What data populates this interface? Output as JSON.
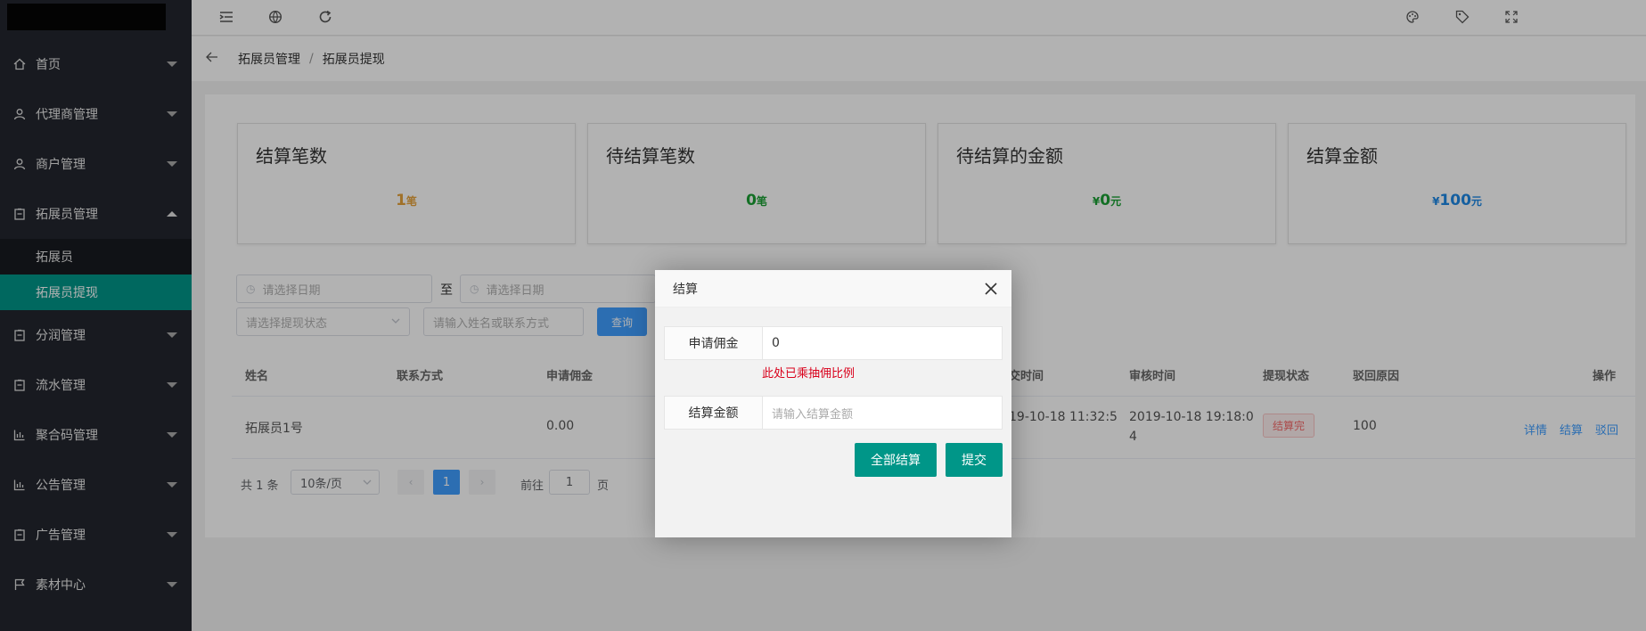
{
  "sidebar": {
    "items": [
      {
        "label": "首页",
        "icon": "home-icon"
      },
      {
        "label": "代理商管理",
        "icon": "user-icon"
      },
      {
        "label": "商户管理",
        "icon": "user-icon"
      },
      {
        "label": "拓展员管理",
        "icon": "clipboard-icon",
        "expanded": true,
        "children": [
          {
            "label": "拓展员"
          },
          {
            "label": "拓展员提现",
            "active": true
          }
        ]
      },
      {
        "label": "分润管理",
        "icon": "clipboard-icon"
      },
      {
        "label": "流水管理",
        "icon": "clipboard-icon"
      },
      {
        "label": "聚合码管理",
        "icon": "chart-icon"
      },
      {
        "label": "公告管理",
        "icon": "chart-icon"
      },
      {
        "label": "广告管理",
        "icon": "clipboard-icon"
      },
      {
        "label": "素材中心",
        "icon": "flag-icon"
      }
    ]
  },
  "topbar": {
    "icons": [
      "indent-icon",
      "globe-icon",
      "refresh-icon",
      "palette-icon",
      "tag-icon",
      "fullscreen-icon"
    ]
  },
  "breadcrumb": {
    "parent": "拓展员管理",
    "separator": "/",
    "current": "拓展员提现"
  },
  "stats": [
    {
      "title": "结算笔数",
      "prefix": "",
      "value": "1",
      "unit": "笔",
      "color": "#e6a23c"
    },
    {
      "title": "待结算笔数",
      "prefix": "",
      "value": "0",
      "unit": "笔",
      "color": "#1aa034"
    },
    {
      "title": "待结算的金额",
      "prefix": "¥",
      "value": "0",
      "unit": "元",
      "color": "#1aa034"
    },
    {
      "title": "结算金额",
      "prefix": "¥",
      "value": "100",
      "unit": "元",
      "color": "#1e88e5"
    }
  ],
  "filters": {
    "date_start_placeholder": "请选择日期",
    "to_label": "至",
    "date_end_placeholder": "请选择日期",
    "status_placeholder": "请选择提现状态",
    "keyword_placeholder": "请输入姓名或联系方式",
    "query_label": "查询"
  },
  "table": {
    "headers": [
      "姓名",
      "联系方式",
      "申请佣金",
      "交时间",
      "审核时间",
      "提现状态",
      "驳回原因",
      "操作"
    ],
    "rows": [
      {
        "name": "拓展员1号",
        "commission": "0.00",
        "submit_time": "19-10-18 11:32:5",
        "audit_time_line1": "2019-10-18 19:18:0",
        "audit_time_line2": "4",
        "status": "结算完",
        "reject_reason": "100",
        "actions": [
          "详情",
          "结算",
          "驳回"
        ]
      }
    ]
  },
  "pagination": {
    "total": "共 1 条",
    "page_size": "10条/页",
    "current_page": "1",
    "goto_label": "前往",
    "goto_value": "1",
    "page_suffix": "页"
  },
  "modal": {
    "title": "结算",
    "commission_label": "申请佣金",
    "commission_value": "0",
    "hint": "此处已乘抽佣比例",
    "amount_label": "结算金额",
    "amount_placeholder": "请输入结算金额",
    "settle_all_label": "全部结算",
    "submit_label": "提交"
  }
}
